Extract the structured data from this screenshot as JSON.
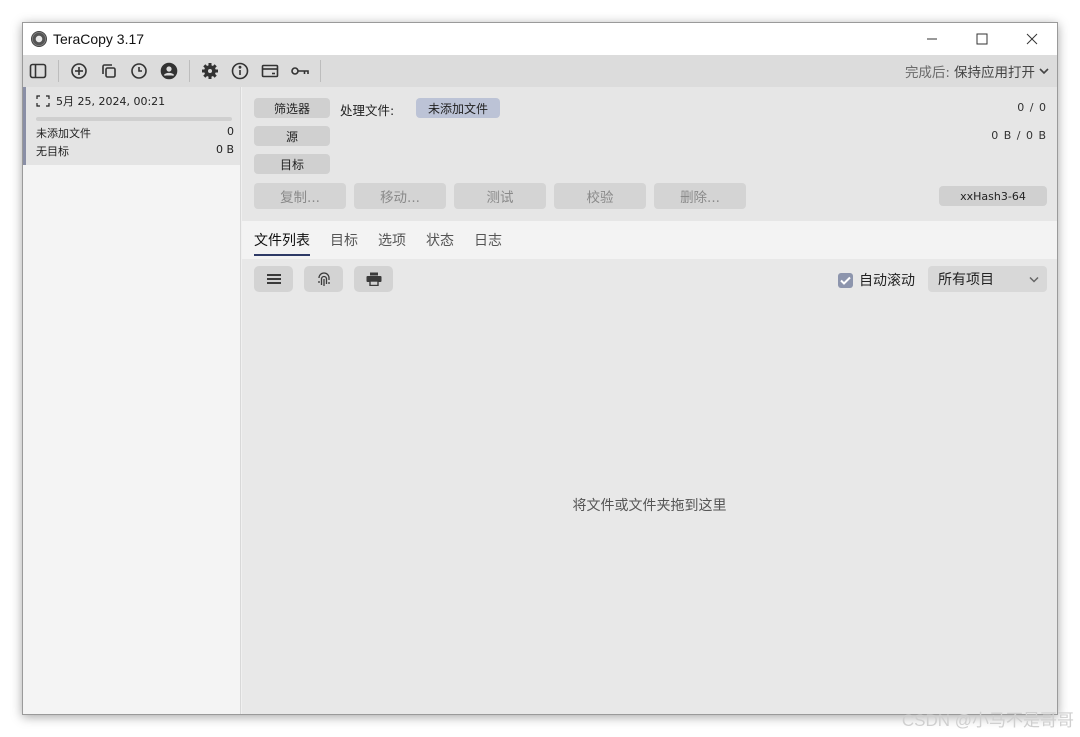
{
  "window": {
    "title": "TeraCopy 3.17"
  },
  "toolbar": {
    "icons": [
      "sidebar-toggle-icon",
      "add-circle-icon",
      "copy-files-icon",
      "history-clock-icon",
      "user-icon",
      "gear-icon",
      "info-icon",
      "card-icon",
      "key-icon"
    ],
    "after_complete_label": "完成后:",
    "after_complete_value": "保持应用打开"
  },
  "sidebar": {
    "session": {
      "datetime": "5月 25, 2024, 00:21",
      "progress": 0,
      "rows": [
        {
          "label": "未添加文件",
          "value": "0"
        },
        {
          "label": "无目标",
          "value": "0 B"
        }
      ]
    }
  },
  "panel": {
    "filter_label": "筛选器",
    "processing_label": "处理文件:",
    "processing_value": "未添加文件",
    "source_label": "源",
    "target_label": "目标",
    "count": "0 / 0",
    "size": "0 B / 0 B",
    "actions": [
      "复制...",
      "移动...",
      "测试",
      "校验",
      "删除..."
    ],
    "hash": "xxHash3-64"
  },
  "tabs": [
    {
      "label": "文件列表",
      "active": true
    },
    {
      "label": "目标",
      "active": false
    },
    {
      "label": "选项",
      "active": false
    },
    {
      "label": "状态",
      "active": false
    },
    {
      "label": "日志",
      "active": false
    }
  ],
  "list": {
    "autoscroll_label": "自动滚动",
    "autoscroll_checked": true,
    "filter_select": "所有项目",
    "drop_hint": "将文件或文件夹拖到这里"
  },
  "watermark": "CSDN @小马不是哥哥",
  "colors": {
    "accent": "#8d95ad",
    "tab_underline": "#2e3a66",
    "pill_highlight": "#bcc3d6"
  }
}
